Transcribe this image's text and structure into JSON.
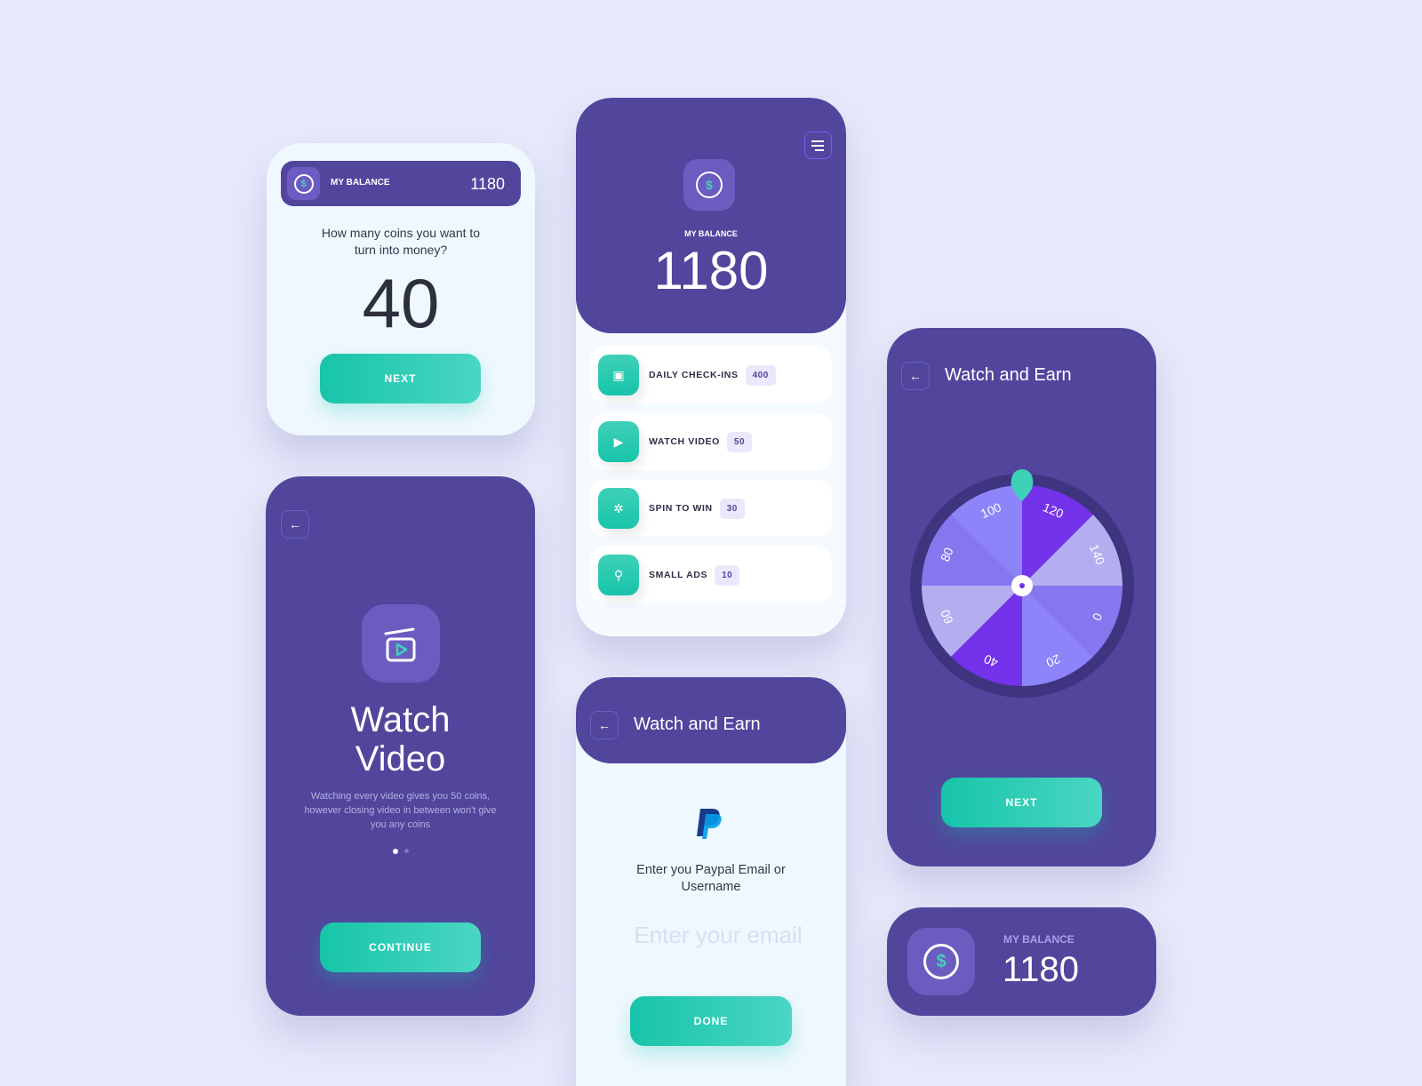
{
  "convert_card": {
    "balance_label": "MY BALANCE",
    "balance_value": "1180",
    "question": "How many coins you want to turn into money?",
    "amount": "40",
    "next_label": "NEXT"
  },
  "video_card": {
    "title_line1": "Watch",
    "title_line2": "Video",
    "description": "Watching every video gives you 50 coins, however closing video in between won't give you any coins",
    "pages": 2,
    "active_page": 1,
    "continue_label": "CONTINUE"
  },
  "home_card": {
    "balance_label": "MY BALANCE",
    "balance_value": "1180",
    "items": [
      {
        "label": "DAILY CHECK-INS",
        "value": "400",
        "icon": "calendar-check-icon"
      },
      {
        "label": "WATCH VIDEO",
        "value": "50",
        "icon": "video-icon"
      },
      {
        "label": "SPIN TO WIN",
        "value": "30",
        "icon": "spin-icon"
      },
      {
        "label": "SMALL ADS",
        "value": "10",
        "icon": "ads-icon"
      }
    ]
  },
  "paypal_card": {
    "title": "Watch and Earn",
    "prompt": "Enter you Paypal Email or Username",
    "email_placeholder": "Enter your email",
    "done_label": "DONE"
  },
  "wheel_card": {
    "title": "Watch and Earn",
    "segments": [
      "120",
      "140",
      "0",
      "20",
      "40",
      "60",
      "80",
      "100"
    ],
    "segment_colors": [
      "#7432ea",
      "#b3aef0",
      "#8677ee",
      "#8d84f9",
      "#7432ea",
      "#b3aef0",
      "#8677ee",
      "#8d84f9"
    ],
    "next_label": "NEXT"
  },
  "balance_card": {
    "balance_label": "MY BALANCE",
    "balance_value": "1180"
  }
}
